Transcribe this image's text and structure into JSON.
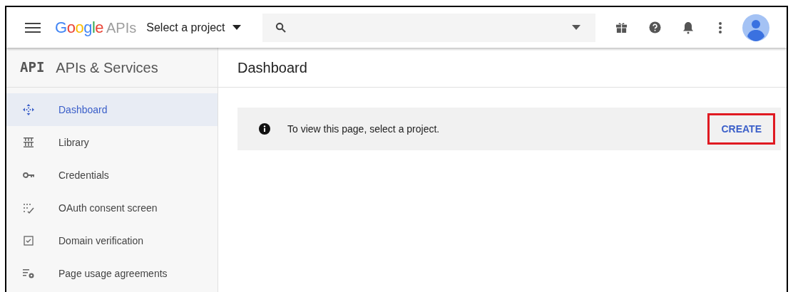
{
  "header": {
    "logo_brand": "Google",
    "logo_product": "APIs",
    "project_picker": "Select a project"
  },
  "sidebar": {
    "badge": "API",
    "title": "APIs & Services",
    "items": [
      {
        "label": "Dashboard",
        "selected": true
      },
      {
        "label": "Library",
        "selected": false
      },
      {
        "label": "Credentials",
        "selected": false
      },
      {
        "label": "OAuth consent screen",
        "selected": false
      },
      {
        "label": "Domain verification",
        "selected": false
      },
      {
        "label": "Page usage agreements",
        "selected": false
      }
    ]
  },
  "main": {
    "title": "Dashboard",
    "notice": {
      "message": "To view this page, select a project.",
      "action": "CREATE",
      "action_highlighted": true
    }
  }
}
